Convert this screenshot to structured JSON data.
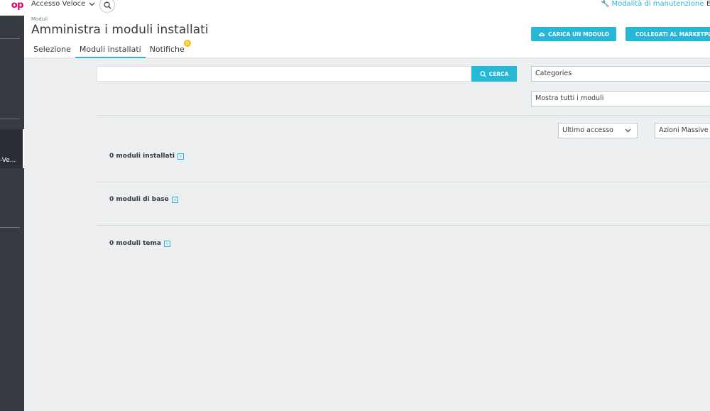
{
  "sidebar": {
    "logo_text": "op",
    "active_item_label": "-Ve..."
  },
  "topbar": {
    "quick_access": "Accesso Veloce",
    "maintenance": "Modalità di manutenzione",
    "right_text": "E"
  },
  "header": {
    "breadcrumb": "Moduli",
    "title": "Amministra i moduli installati",
    "tabs": [
      {
        "label": "Selezione"
      },
      {
        "label": "Moduli installati"
      },
      {
        "label": "Notifiche",
        "badge": "0"
      }
    ],
    "upload_button": "CARICA UN MODULO",
    "marketplace_button": "COLLEGATI AL MARKETPLACE"
  },
  "search": {
    "placeholder": "",
    "button_label": "CERCA"
  },
  "filters": {
    "categories": "Categories",
    "show_all": "Mostra tutti i moduli",
    "sort": "Ultimo accesso",
    "bulk_actions": "Azioni Massive"
  },
  "sections": [
    {
      "title": "0 moduli installati"
    },
    {
      "title": "0 moduli di base"
    },
    {
      "title": "0 moduli tema"
    }
  ],
  "colors": {
    "accent": "#25b9d7",
    "sidebar": "#363a41",
    "badge": "#fbbb22",
    "brand": "#df0067"
  }
}
